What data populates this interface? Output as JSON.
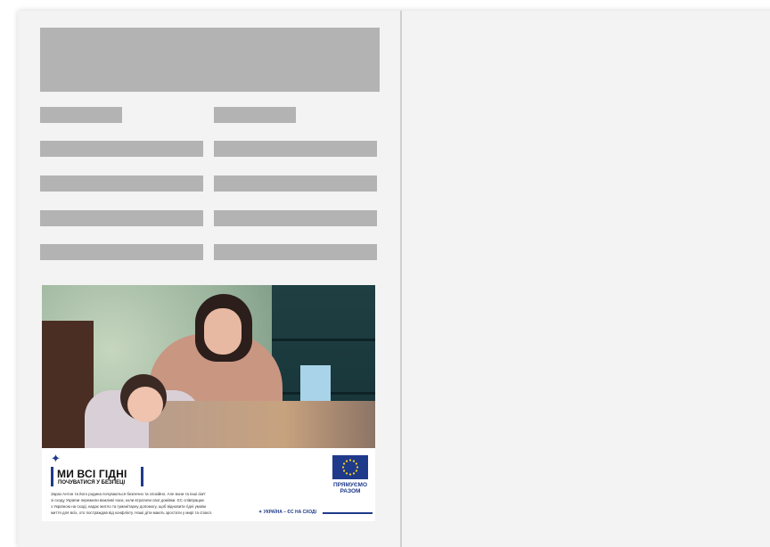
{
  "ad": {
    "headline": "МИ ВСІ ГІДНІ",
    "subheadline": "ПОЧУВАТИСЯ У БЕЗПЕЦІ",
    "body": "Зараз Антон та його родина почуваються безпечно та спокійно. Але вони та інші сім'ї\nзі сходу України пережили важливі часи, коли втратили свої домівки. ЄС співпрацює\nз Україною на сході, надає житло та гуманітарну допомогу, щоб відновити гідні умови\nжиття для всіх, хто постраждав від конфлікту. Наші діти мають зростати у мирі та спокої.",
    "partner_label": "ПРЯМУЄМО\nРАЗОМ",
    "footer_slogan": "✦ УКРАЇНА – ЄС НА СХОДІ",
    "icons": [
      "star-icon",
      "eu-flag-icon"
    ],
    "colors": {
      "accent": "#1f3a8a",
      "placeholder": "#b3b3b3",
      "panel": "#f3f3f3"
    }
  }
}
